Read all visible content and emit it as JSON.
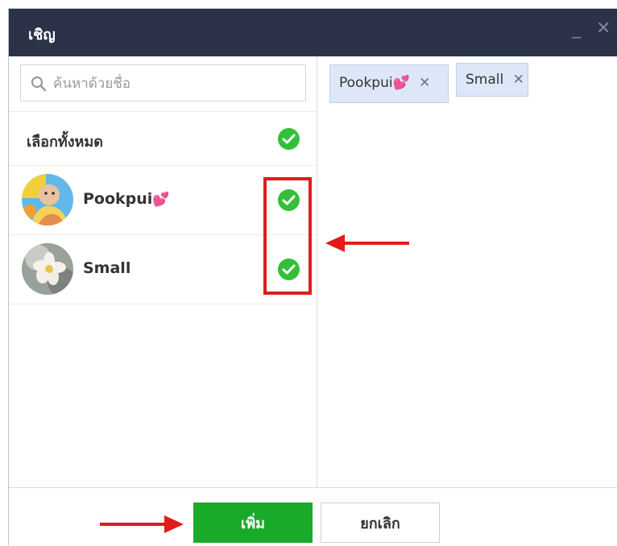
{
  "window": {
    "title": "เชิญ",
    "minimize_glyph": "_",
    "close_glyph": "✕"
  },
  "search": {
    "placeholder": "ค้นหาด้วยชื่อ"
  },
  "select_all": {
    "label": "เลือกทั้งหมด",
    "checked": true
  },
  "friends": [
    {
      "name": "Pookpui",
      "emoji": "💕",
      "checked": true,
      "avatar": "child-photo"
    },
    {
      "name": "Small",
      "checked": true,
      "avatar": "flower-photo"
    }
  ],
  "selected_chips": [
    {
      "label": "Pookpui",
      "emoji": "💕",
      "remove": "✕"
    },
    {
      "label": "Small",
      "remove": "✕"
    }
  ],
  "buttons": {
    "add": "เพิ่ม",
    "cancel": "ยกเลิก"
  },
  "annotations": {
    "highlight_color": "#e31b1b",
    "arrow_color": "#e31b1b"
  },
  "colors": {
    "titlebar": "#2c3248",
    "check": "#35bf39",
    "add_button": "#1aaa2a",
    "chip": "#dde7f7"
  }
}
